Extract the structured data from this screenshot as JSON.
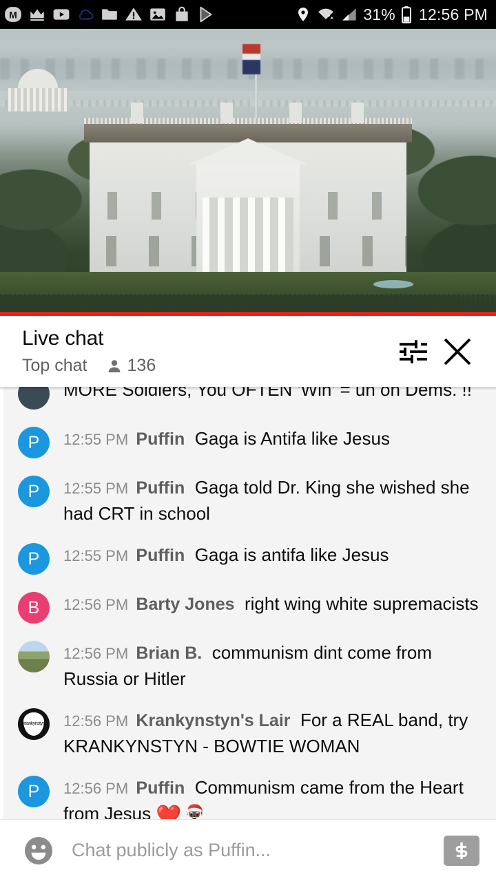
{
  "status_bar": {
    "icons_left": [
      "m-badge-icon",
      "crown-icon",
      "youtube-icon",
      "cloud-icon",
      "folder-icon",
      "warning-triangle-icon",
      "photo-icon",
      "shopping-bag-icon",
      "play-store-icon"
    ],
    "location_icon": "location-pin-icon",
    "wifi_icon": "wifi-icon",
    "signal_icon": "cellular-signal-icon",
    "battery_percent": "31%",
    "battery_icon": "battery-icon",
    "clock": "12:56 PM"
  },
  "video": {
    "label": "white-house-live-stream",
    "progress_color": "#e62117",
    "progress_percent": 100
  },
  "chat_header": {
    "title": "Live chat",
    "subtitle": "Top chat",
    "viewer_count": "136",
    "viewer_icon": "person-icon",
    "settings_icon": "tune-sliders-icon",
    "close_icon": "close-x-icon"
  },
  "messages": [
    {
      "clipped": true,
      "avatar_type": "dark",
      "avatar_letter": "",
      "avatar_color": "#3b4b55",
      "time": "",
      "author": "",
      "text": "MORE Soldiers, You OFTEN 'Win' = uh oh Dems. !!"
    },
    {
      "clipped": false,
      "avatar_type": "letter",
      "avatar_letter": "P",
      "avatar_color": "#1b97e0",
      "time": "12:55 PM",
      "author": "Puffin",
      "text": "Gaga is Antifa like Jesus"
    },
    {
      "clipped": false,
      "avatar_type": "letter",
      "avatar_letter": "P",
      "avatar_color": "#1b97e0",
      "time": "12:55 PM",
      "author": "Puffin",
      "text": "Gaga told Dr. King she wished she had CRT in school"
    },
    {
      "clipped": false,
      "avatar_type": "letter",
      "avatar_letter": "P",
      "avatar_color": "#1b97e0",
      "time": "12:55 PM",
      "author": "Puffin",
      "text": "Gaga is antifa like Jesus"
    },
    {
      "clipped": false,
      "avatar_type": "letter",
      "avatar_letter": "B",
      "avatar_color": "#ea3e73",
      "time": "12:56 PM",
      "author": "Barty Jones",
      "text": "right wing white supremacists"
    },
    {
      "clipped": false,
      "avatar_type": "photo-land",
      "avatar_letter": "",
      "avatar_color": "",
      "time": "12:56 PM",
      "author": "Brian B.",
      "text": "communism dint come from Russia or Hitler"
    },
    {
      "clipped": false,
      "avatar_type": "photo-pick",
      "avatar_letter": "",
      "avatar_color": "#111111",
      "avatar_caption": "krankynstyn",
      "time": "12:56 PM",
      "author": "Krankynstyn's Lair",
      "text": "For a REAL band, try KRANKYNSTYN - BOWTIE WOMAN"
    },
    {
      "clipped": false,
      "avatar_type": "letter",
      "avatar_letter": "P",
      "avatar_color": "#1b97e0",
      "time": "12:56 PM",
      "author": "Puffin",
      "text": "Communism came from the Heart from Jesus ",
      "emoji": "❤️🎅🏿"
    }
  ],
  "composer": {
    "emoji_icon": "emoji-smiley-icon",
    "placeholder": "Chat publicly as Puffin...",
    "value": "",
    "superchat_icon": "dollar-superchat-icon"
  }
}
